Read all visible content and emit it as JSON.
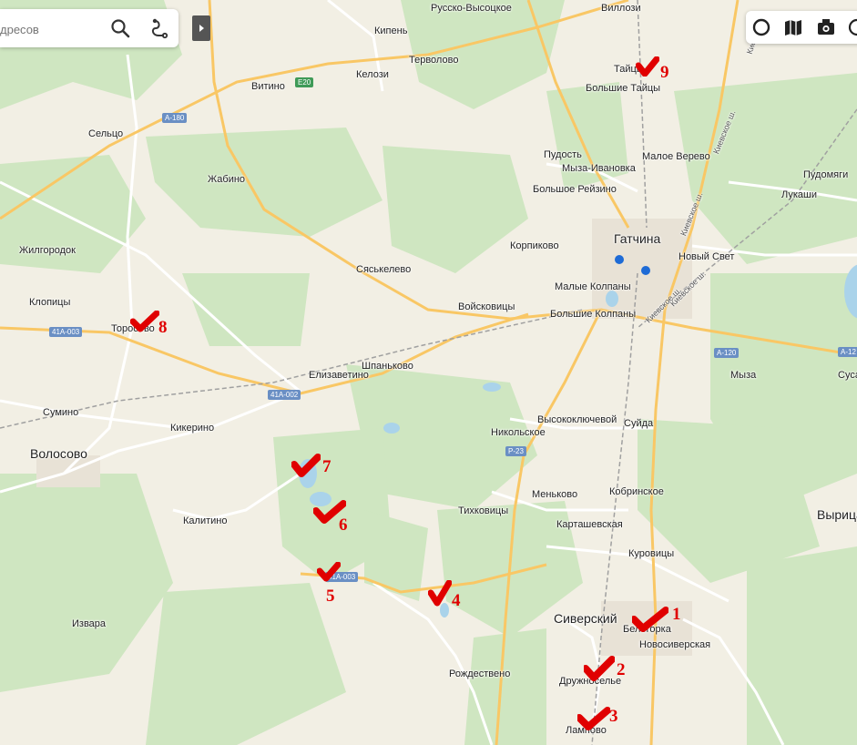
{
  "search": {
    "placeholder": "дресов"
  },
  "toolbar": {
    "icons": [
      "traffic-icon",
      "layers-icon",
      "panorama-icon",
      "more-icon"
    ]
  },
  "places": {
    "russko": "Русско-Высоцкое",
    "villozi": "Виллози",
    "kipen": "Кипень",
    "tervolovo": "Терволово",
    "vitino": "Витино",
    "kelozi": "Келози",
    "taicy": "Тайцы",
    "bolshie_taicy": "Большие Тайцы",
    "selco": "Сельцо",
    "pudost": "Пудость",
    "malo_verevo": "Малое Верево",
    "myza_ivanovka": "Мыза-Ивановка",
    "pudomyagi": "Пудомяги",
    "zhabino": "Жабино",
    "bolshoe_reizino": "Большое Рейзино",
    "lukashi": "Лукаши",
    "gatchina": "Гатчина",
    "zhilgorodok": "Жилгородок",
    "koprikovo": "Корпиково",
    "novy_svet": "Новый Свет",
    "syaskelevo": "Сяськелево",
    "malye_kolpany": "Малые Колпаны",
    "klopicy": "Клопицы",
    "voiskovicy": "Войсковицы",
    "bolshie_kolpany": "Большие Колпаны",
    "torosovo": "Торосово",
    "shpankovo": "Шпаньково",
    "myza": "Мыза",
    "elizavetino": "Елизаветино",
    "suse": "Суса",
    "sumino": "Сумино",
    "vysokoklyuchevoi": "Высокоключевой",
    "kikerino": "Кикерино",
    "suida": "Суйда",
    "nikolskoe": "Никольское",
    "volosovo": "Волосово",
    "menkovo": "Меньково",
    "kobrinskoe": "Кобринское",
    "tihkovicy": "Тихковицы",
    "kalitino": "Калитино",
    "kartashevskaya": "Карташевская",
    "vyrica": "Вырица",
    "kurovicy": "Куровицы",
    "siversky": "Сиверский",
    "belogorka": "Белогорка",
    "izvara": "Извара",
    "novosiverskaya": "Новосиверская",
    "rozhdestveno": "Рождествено",
    "druzhnoselye": "Дружноселье",
    "lampovo": "Лампово"
  },
  "streets": {
    "kievskoe_1": "Киевское ш.",
    "kievskoe_2": "Киевское ш.",
    "kievskoe_3": "Киевское ш.",
    "kievskoe_4": "Киевское ш.",
    "kievskoe_5": "Киевское ш."
  },
  "shields": {
    "e20": "E20",
    "a180": "А-180",
    "r41a003_a": "41А-003",
    "r41a002": "41А-002",
    "r41a003_b": "41А-003",
    "a120": "А-120",
    "a12x": "А-12",
    "p23": "Р-23"
  },
  "markers": [
    {
      "num": "1"
    },
    {
      "num": "2"
    },
    {
      "num": "3"
    },
    {
      "num": "4"
    },
    {
      "num": "5"
    },
    {
      "num": "6"
    },
    {
      "num": "7"
    },
    {
      "num": "8"
    },
    {
      "num": "9"
    }
  ],
  "colors": {
    "land": "#f2efe4",
    "forest": "#cfe6c1",
    "water": "#aad3ea",
    "road_major": "#f9c765",
    "road_minor": "#ffffff",
    "rail": "#a0a0a0",
    "marker": "#e00000"
  }
}
